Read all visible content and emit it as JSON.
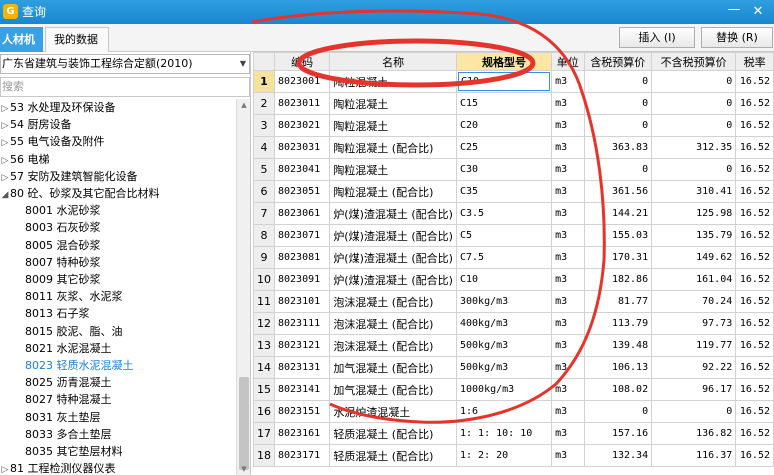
{
  "window": {
    "title": "查询",
    "app_icon_glyph": "G",
    "minimize_glyph": "—",
    "close_glyph": "✕"
  },
  "toolbar": {
    "tab_active": "人材机",
    "tab_other": "我的数据",
    "insert_label": "插入 (I)",
    "replace_label": "替换 (R)"
  },
  "left": {
    "dropdown_value": "广东省建筑与装饰工程综合定额(2010)",
    "search_placeholder": "搜索",
    "tree": [
      {
        "label": "53 水处理及环保设备",
        "level": 0,
        "state": "collapsed"
      },
      {
        "label": "54 厨房设备",
        "level": 0,
        "state": "collapsed"
      },
      {
        "label": "55 电气设备及附件",
        "level": 0,
        "state": "collapsed"
      },
      {
        "label": "56 电梯",
        "level": 0,
        "state": "collapsed"
      },
      {
        "label": "57 安防及建筑智能化设备",
        "level": 0,
        "state": "collapsed"
      },
      {
        "label": "80 砼、砂浆及其它配合比材料",
        "level": 0,
        "state": "expanded"
      },
      {
        "label": "8001 水泥砂浆",
        "level": 1
      },
      {
        "label": "8003 石灰砂浆",
        "level": 1
      },
      {
        "label": "8005 混合砂浆",
        "level": 1
      },
      {
        "label": "8007 特种砂浆",
        "level": 1
      },
      {
        "label": "8009 其它砂浆",
        "level": 1
      },
      {
        "label": "8011 灰浆、水泥浆",
        "level": 1
      },
      {
        "label": "8013 石子浆",
        "level": 1
      },
      {
        "label": "8015 胶泥、脂、油",
        "level": 1
      },
      {
        "label": "8021 水泥混凝土",
        "level": 1
      },
      {
        "label": "8023 轻质水泥混凝土",
        "level": 1,
        "selected": true
      },
      {
        "label": "8025 沥青混凝土",
        "level": 1
      },
      {
        "label": "8027 特种混凝土",
        "level": 1
      },
      {
        "label": "8031 灰土垫层",
        "level": 1
      },
      {
        "label": "8033 多合土垫层",
        "level": 1
      },
      {
        "label": "8035 其它垫层材料",
        "level": 1
      },
      {
        "label": "81 工程检测仪器仪表",
        "level": 0,
        "state": "collapsed"
      }
    ]
  },
  "grid": {
    "columns": [
      "",
      "编码",
      "名称",
      "规格型号",
      "单位",
      "含税预算价",
      "不含税预算价",
      "税率"
    ],
    "rows": [
      [
        "1",
        "8023001",
        "陶粒混凝土",
        "C10",
        "m3",
        "0",
        "0",
        "16.52"
      ],
      [
        "2",
        "8023011",
        "陶粒混凝土",
        "C15",
        "m3",
        "0",
        "0",
        "16.52"
      ],
      [
        "3",
        "8023021",
        "陶粒混凝土",
        "C20",
        "m3",
        "0",
        "0",
        "16.52"
      ],
      [
        "4",
        "8023031",
        "陶粒混凝土 (配合比)",
        "C25",
        "m3",
        "363.83",
        "312.35",
        "16.52"
      ],
      [
        "5",
        "8023041",
        "陶粒混凝土",
        "C30",
        "m3",
        "0",
        "0",
        "16.52"
      ],
      [
        "6",
        "8023051",
        "陶粒混凝土 (配合比)",
        "C35",
        "m3",
        "361.56",
        "310.41",
        "16.52"
      ],
      [
        "7",
        "8023061",
        "炉(煤)渣混凝土 (配合比)",
        "C3.5",
        "m3",
        "144.21",
        "125.98",
        "16.52"
      ],
      [
        "8",
        "8023071",
        "炉(煤)渣混凝土 (配合比)",
        "C5",
        "m3",
        "155.03",
        "135.79",
        "16.52"
      ],
      [
        "9",
        "8023081",
        "炉(煤)渣混凝土 (配合比)",
        "C7.5",
        "m3",
        "170.31",
        "149.62",
        "16.52"
      ],
      [
        "10",
        "8023091",
        "炉(煤)渣混凝土 (配合比)",
        "C10",
        "m3",
        "182.86",
        "161.04",
        "16.52"
      ],
      [
        "11",
        "8023101",
        "泡沫混凝土 (配合比)",
        "300kg/m3",
        "m3",
        "81.77",
        "70.24",
        "16.52"
      ],
      [
        "12",
        "8023111",
        "泡沫混凝土 (配合比)",
        "400kg/m3",
        "m3",
        "113.79",
        "97.73",
        "16.52"
      ],
      [
        "13",
        "8023121",
        "泡沫混凝土 (配合比)",
        "500kg/m3",
        "m3",
        "139.48",
        "119.77",
        "16.52"
      ],
      [
        "14",
        "8023131",
        "加气混凝土 (配合比)",
        "500kg/m3",
        "m3",
        "106.13",
        "92.22",
        "16.52"
      ],
      [
        "15",
        "8023141",
        "加气混凝土 (配合比)",
        "1000kg/m3",
        "m3",
        "108.02",
        "96.17",
        "16.52"
      ],
      [
        "16",
        "8023151",
        "水泥炉渣混凝土",
        "1:6",
        "m3",
        "0",
        "0",
        "16.52"
      ],
      [
        "17",
        "8023161",
        "轻质混凝土 (配合比)",
        "1: 1: 10: 10",
        "m3",
        "157.16",
        "136.82",
        "16.52"
      ],
      [
        "18",
        "8023171",
        "轻质混凝土 (配合比)",
        "1: 2: 20",
        "m3",
        "132.34",
        "116.37",
        "16.52"
      ]
    ]
  },
  "colors": {
    "title_bar": "#1a86cf",
    "accent_tab": "#3aa2e4",
    "header_highlight": "#fce6a3",
    "annotation": "#e5342c",
    "tree_selected": "#1a7fd6"
  }
}
